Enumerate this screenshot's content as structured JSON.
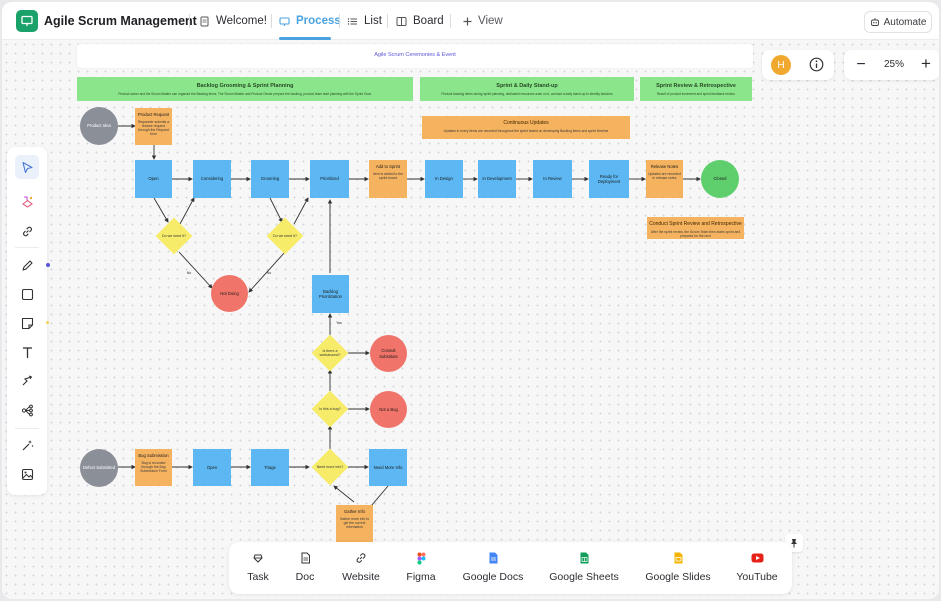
{
  "app": {
    "title": "Agile Scrum Management",
    "icon": "whiteboard-icon"
  },
  "tabs": [
    {
      "label": "Welcome!",
      "icon": "doc-icon"
    },
    {
      "label": "Process",
      "icon": "whiteboard-icon",
      "active": true
    },
    {
      "label": "List",
      "icon": "list-icon"
    },
    {
      "label": "Board",
      "icon": "board-icon"
    },
    {
      "label": "View",
      "icon": "plus-icon"
    }
  ],
  "automate_label": "Automate",
  "user": {
    "initial": "H"
  },
  "zoom": {
    "value": "25%",
    "minus": "−",
    "plus": "+"
  },
  "left_tools": [
    "select-icon",
    "ai-shapes-icon",
    "link-icon",
    "pen-icon",
    "rectangle-icon",
    "sticky-note-icon",
    "text-icon",
    "connector-icon",
    "mind-map-icon",
    "magic-icon",
    "image-icon"
  ],
  "bottom_bar": [
    {
      "label": "Task",
      "icon": "task-icon"
    },
    {
      "label": "Doc",
      "icon": "doc-icon"
    },
    {
      "label": "Website",
      "icon": "link-icon"
    },
    {
      "label": "Figma",
      "icon": "figma-icon"
    },
    {
      "label": "Google Docs",
      "icon": "google-docs-icon"
    },
    {
      "label": "Google Sheets",
      "icon": "google-sheets-icon"
    },
    {
      "label": "Google Slides",
      "icon": "google-slides-icon"
    },
    {
      "label": "YouTube",
      "icon": "youtube-icon"
    }
  ],
  "diagram": {
    "header": "Agile Scrum Ceremonies & Event",
    "bands": [
      {
        "title": "Backlog Grooming & Sprint Planning",
        "text": "Product owner and the Scrum Master can organize the Backlog items. The Scrum Master and Product Owner prepare the backlog, product team start planning with the Sprint Goal."
      },
      {
        "title": "Sprint & Daily Stand-up",
        "text": "Product backlog items during sprint planning, dedicated resources work on it, conduct a daily stand-up to identify blockers"
      },
      {
        "title": "Sprint Review & Retrospective",
        "text": "Result of product increment and sprint feedback review."
      }
    ],
    "continuous": {
      "title": "Continuous Updates",
      "text": "Updates in every items are recorded throughout the sprint based on developing Backlog items and sprint timeline"
    },
    "retro": {
      "title": "Conduct Sprint Review and Retrospective",
      "text": "After the sprint review, the Scrum Team then starts sprint and prepares for the next"
    },
    "nodes": {
      "product_idea": "Product Idea",
      "product_request": "Product Request",
      "product_request_text": "Requester submits a feature request through the Request form",
      "open": "Open",
      "considering": "Considering",
      "grooming": "Grooming",
      "prioritized": "Prioritized",
      "add_sprint": "Add to Sprint",
      "add_sprint_text": "Item is added to the sprint board",
      "in_design": "In Design",
      "in_development": "In Development",
      "in_review": "In Review",
      "ready_deploy": "Ready for Deployment",
      "release_notes": "Release Notes",
      "release_notes_text": "Updates are recorded in release notes",
      "closed": "Closed",
      "decision1": "Do we need it?",
      "decision2": "Do we need it?",
      "not_doing": "Not Doing",
      "label_no1": "No",
      "label_no2": "No",
      "backlog_prioritization": "Backlog Prioritization",
      "yes": "Yes",
      "decision3": "Is there a workaround?",
      "consult": "Consult Substitute",
      "decision4": "Is this a bug?",
      "not_bug": "Not a Bug",
      "defect": "Defect Submitted",
      "bug_submission": "Bug Submission",
      "bug_submission_text": "Bug is recorded through the Bug Submission Form",
      "open2": "Open",
      "triage": "Triage",
      "decision5": "Need more info?",
      "need_more_info": "Need More Info",
      "gather_info": "Gather Info",
      "gather_info_text": "Gather more info to get the correct information"
    }
  },
  "colors": {
    "accent": "#4aa3df",
    "green_band": "#8be58a",
    "blue_node": "#5cb7f2",
    "orange_node": "#f5b25f",
    "yellow_decision": "#f7ec6a",
    "red_circle": "#f07469",
    "green_circle": "#5ecf6c",
    "gray_circle": "#8b8f98"
  }
}
